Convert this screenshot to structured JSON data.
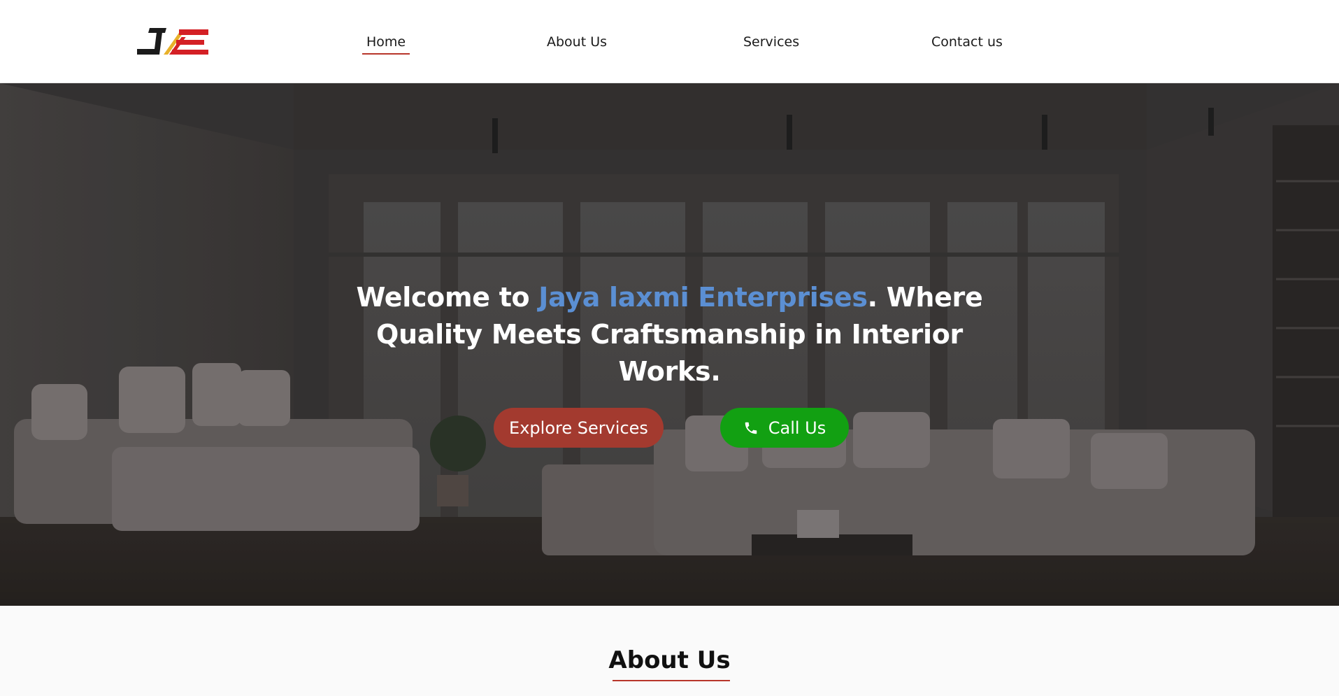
{
  "header": {
    "logo_alt": "JE logo",
    "nav": {
      "home": "Home",
      "about": "About Us",
      "services": "Services",
      "contact": "Contact us"
    },
    "active_item": "Home",
    "active_underline_color": "#b8362b"
  },
  "hero": {
    "title_prefix": "Welcome to ",
    "title_brand": "Jaya laxmi Enterprises",
    "title_suffix": ". Where Quality Meets Craftsmanship in Interior Works.",
    "brand_color": "#5b8fd3",
    "explore_button": "Explore Services",
    "explore_button_color": "#a33a2f",
    "call_button": "Call Us",
    "call_button_color": "#12a012",
    "call_icon": "phone-icon"
  },
  "about": {
    "heading": "About Us"
  }
}
